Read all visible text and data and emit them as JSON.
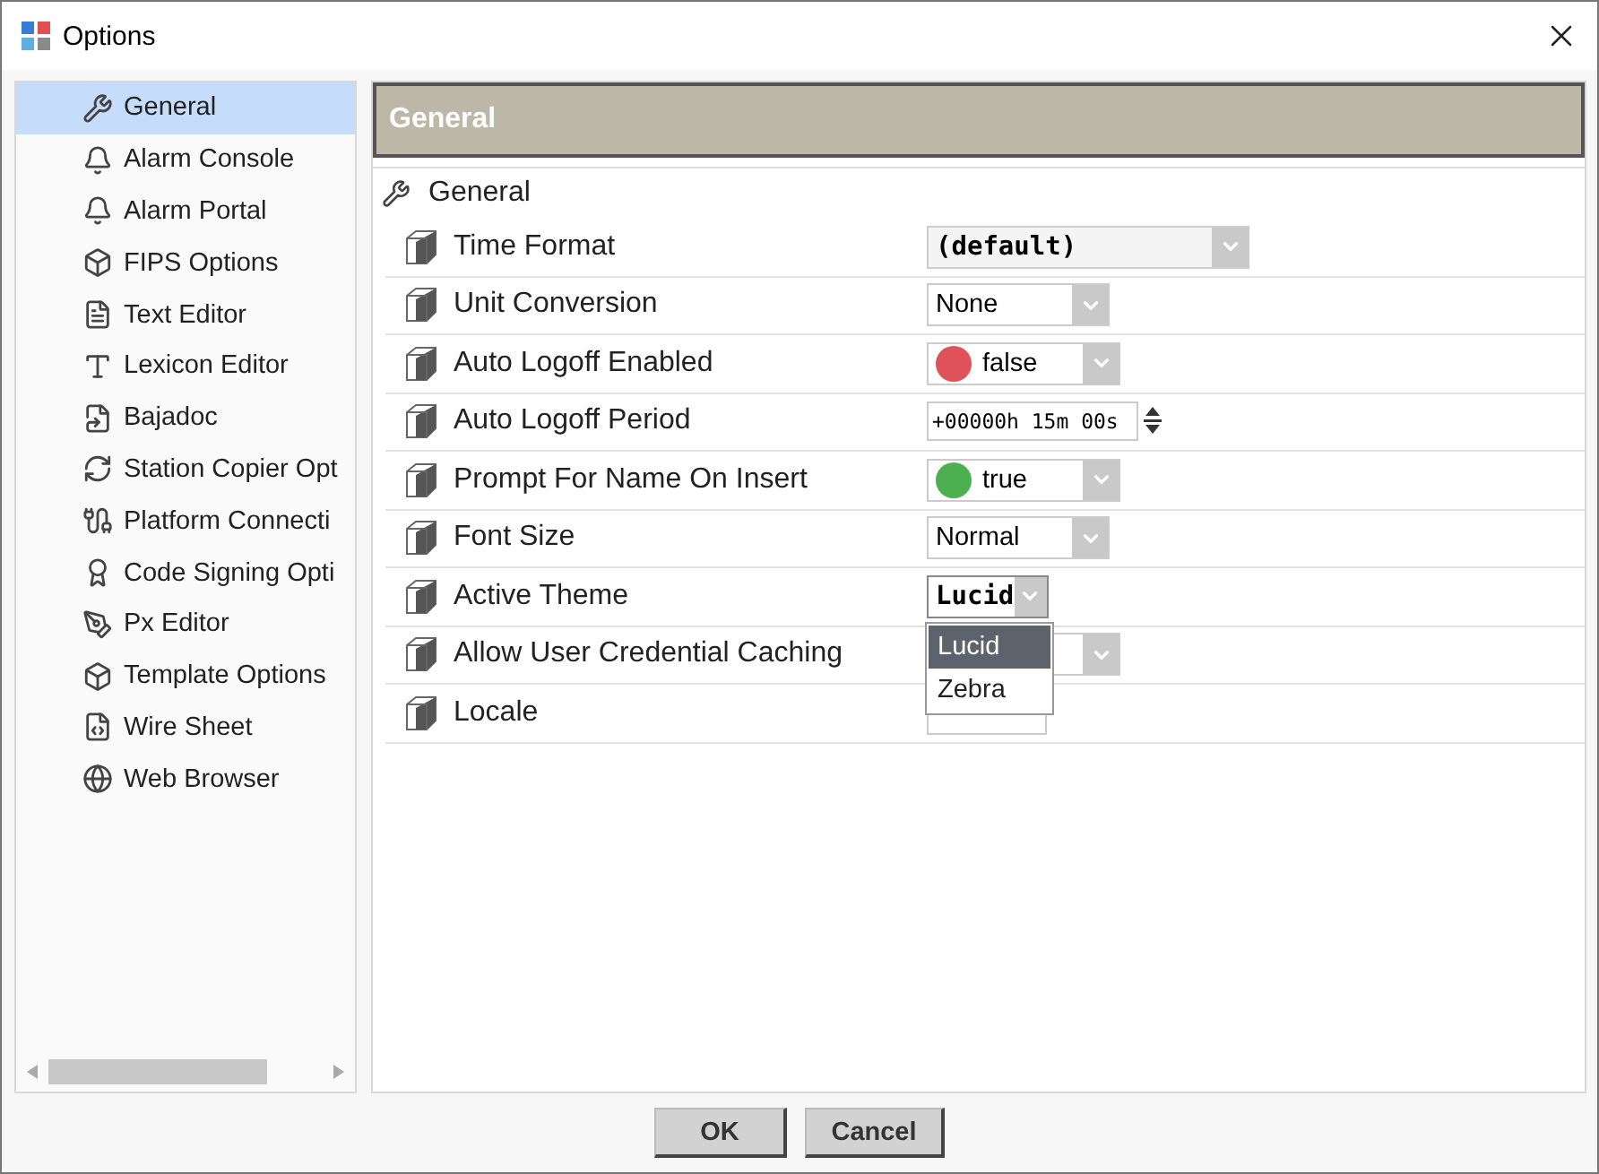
{
  "window": {
    "title": "Options"
  },
  "sidebar": {
    "items": [
      {
        "label": "General",
        "selected": true
      },
      {
        "label": "Alarm Console",
        "selected": false
      },
      {
        "label": "Alarm Portal",
        "selected": false
      },
      {
        "label": "FIPS Options",
        "selected": false
      },
      {
        "label": "Text Editor",
        "selected": false
      },
      {
        "label": "Lexicon Editor",
        "selected": false
      },
      {
        "label": "Bajadoc",
        "selected": false
      },
      {
        "label": "Station Copier Opt",
        "selected": false
      },
      {
        "label": "Platform Connecti",
        "selected": false
      },
      {
        "label": "Code Signing Opti",
        "selected": false
      },
      {
        "label": "Px Editor",
        "selected": false
      },
      {
        "label": "Template Options",
        "selected": false
      },
      {
        "label": "Wire Sheet",
        "selected": false
      },
      {
        "label": "Web Browser",
        "selected": false
      }
    ]
  },
  "panel": {
    "header": "General",
    "group": "General",
    "properties": [
      {
        "name": "Time Format",
        "kind": "wide-dropdown",
        "value": "(default)"
      },
      {
        "name": "Unit Conversion",
        "kind": "dropdown",
        "value": "None"
      },
      {
        "name": "Auto Logoff Enabled",
        "kind": "bool",
        "value": "false",
        "color": "#e0525a"
      },
      {
        "name": "Auto Logoff Period",
        "kind": "spinner",
        "value": "+00000h 15m 00s"
      },
      {
        "name": "Prompt For Name On Insert",
        "kind": "bool",
        "value": "true",
        "color": "#4caf50"
      },
      {
        "name": "Font Size",
        "kind": "dropdown",
        "value": "Normal"
      },
      {
        "name": "Active Theme",
        "kind": "small-dropdown",
        "value": "Lucid",
        "expanded": true,
        "options": [
          {
            "label": "Lucid",
            "selected": true
          },
          {
            "label": "Zebra",
            "selected": false
          }
        ]
      },
      {
        "name": "Allow User Credential Caching",
        "kind": "bool-hidden"
      },
      {
        "name": "Locale",
        "kind": "field-hidden"
      }
    ]
  },
  "buttons": [
    "OK",
    "Cancel"
  ]
}
